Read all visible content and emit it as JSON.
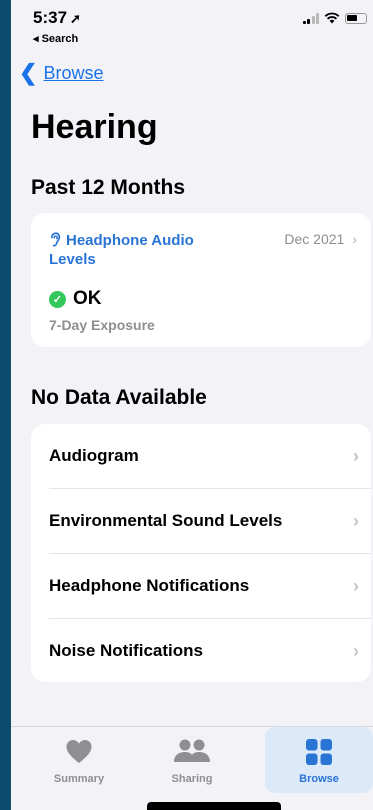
{
  "status_bar": {
    "time": "5:37",
    "location_arrow": "➚",
    "back_app_label": "◂ Search"
  },
  "nav": {
    "back_chevron": "❮",
    "back_label": "Browse"
  },
  "page": {
    "title": "Hearing"
  },
  "sections": {
    "past_title": "Past 12 Months",
    "no_data_title": "No Data Available"
  },
  "headphone_card": {
    "title": "Headphone Audio Levels",
    "date": "Dec 2021",
    "status": "OK",
    "subtitle": "7-Day Exposure",
    "icon": "ear-icon"
  },
  "list": {
    "items": [
      {
        "label": "Audiogram"
      },
      {
        "label": "Environmental Sound Levels"
      },
      {
        "label": "Headphone Notifications"
      },
      {
        "label": "Noise Notifications"
      }
    ],
    "chevron": "›"
  },
  "tabbar": {
    "tabs": [
      {
        "label": "Summary",
        "icon": "heart-icon",
        "active": false
      },
      {
        "label": "Sharing",
        "icon": "people-icon",
        "active": false
      },
      {
        "label": "Browse",
        "icon": "grid-icon",
        "active": true
      }
    ]
  },
  "colors": {
    "accent": "#2a74d6",
    "ok_green": "#34c759",
    "background": "#f2f2f7",
    "outer_frame": "#0d4a6e"
  }
}
